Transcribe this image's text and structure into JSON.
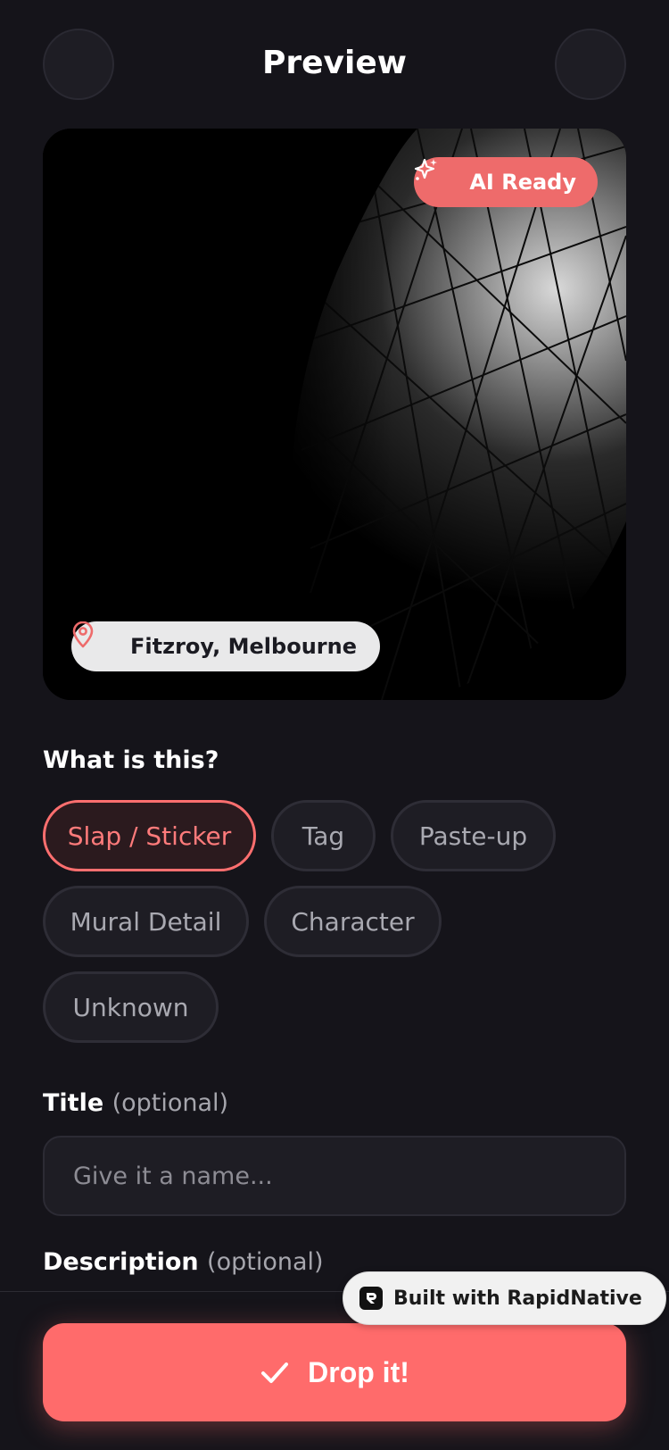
{
  "header": {
    "title": "Preview",
    "left_button_icon": "back-icon",
    "right_button_icon": "more-icon"
  },
  "photo": {
    "ai_badge": "AI Ready",
    "ai_badge_icon": "sparkles-icon",
    "location": "Fitzroy, Melbourne",
    "location_icon": "map-pin-icon"
  },
  "category": {
    "label": "What is this?",
    "selected": "Slap / Sticker",
    "options": [
      "Slap / Sticker",
      "Tag",
      "Paste-up",
      "Mural Detail",
      "Character",
      "Unknown"
    ]
  },
  "title_field": {
    "label": "Title",
    "optional": "(optional)",
    "placeholder": "Give it a name..."
  },
  "description_field": {
    "label": "Description",
    "optional": "(optional)"
  },
  "submit": {
    "label": "Drop it!",
    "icon": "check-icon"
  },
  "built_with": {
    "label": "Built with RapidNative"
  },
  "colors": {
    "accent": "#ff6b6b",
    "background": "#15141a",
    "surface": "#1e1d24"
  }
}
